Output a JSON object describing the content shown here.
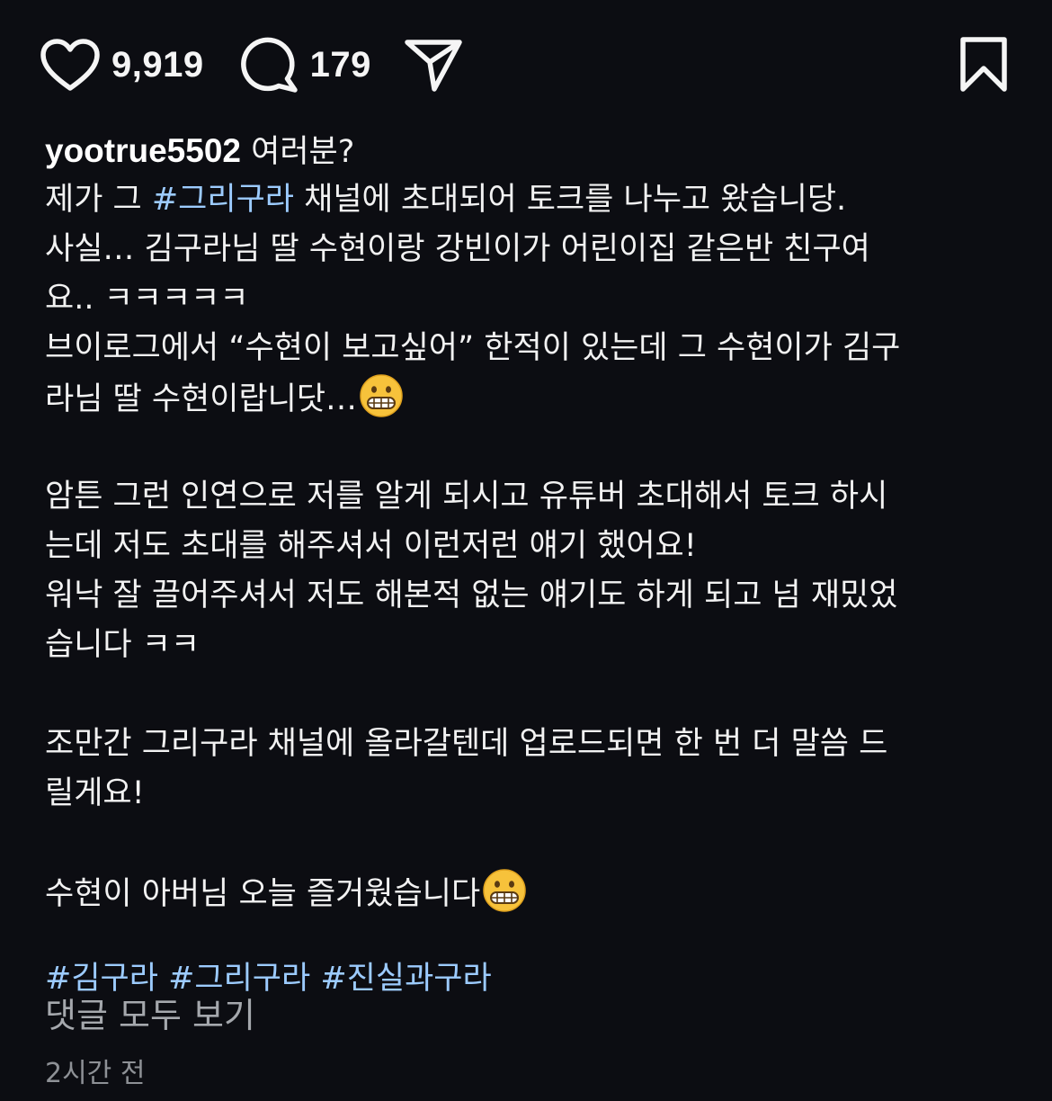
{
  "actions": {
    "likes_count": "9,919",
    "comments_count": "179",
    "like_icon": "heart-outline-icon",
    "comment_icon": "speech-bubble-icon",
    "share_icon": "paper-plane-icon",
    "save_icon": "bookmark-outline-icon"
  },
  "caption": {
    "username": "yootrue5502",
    "line1_text": " 여러분?",
    "line2_before": "제가 그 ",
    "line2_tag": "#그리구라",
    "line2_after": " 채널에 초대되어 토크를 나누고 왔습니당.",
    "line3": "사실… 김구라님 딸 수현이랑 강빈이가 어린이집 같은반 친구여",
    "line4": "요.. ㅋㅋㅋㅋㅋ",
    "line5": "브이로그에서 “수현이 보고싶어” 한적이 있는데 그 수현이가 김구",
    "line6": "라님 딸 수현이랍니닷…",
    "line7": "암튼 그런 인연으로 저를 알게 되시고 유튜버 초대해서 토크 하시",
    "line8": "는데 저도 초대를 해주셔서 이런저런 얘기 했어요!",
    "line9": "워낙 잘 끌어주셔서 저도 해본적 없는 얘기도 하게 되고 넘 재밌었",
    "line10": "습니다 ㅋㅋ",
    "line11": "조만간 그리구라 채널에 올라갈텐데 업로드되면 한 번 더 말씀 드",
    "line12": "릴게요!",
    "line13": "수현이 아버님 오늘 즐거웠습니다",
    "emoji_icon": "grimacing-face-emoji",
    "hashtags": [
      "#김구라",
      "#그리구라",
      "#진실과구라"
    ]
  },
  "footer": {
    "view_all_comments": "댓글 모두 보기",
    "timestamp": "2시간 전"
  },
  "colors": {
    "background": "#0c0d12",
    "text": "#f2f2f2",
    "hashtag": "#9ccbff",
    "muted": "#a5a8ad"
  }
}
